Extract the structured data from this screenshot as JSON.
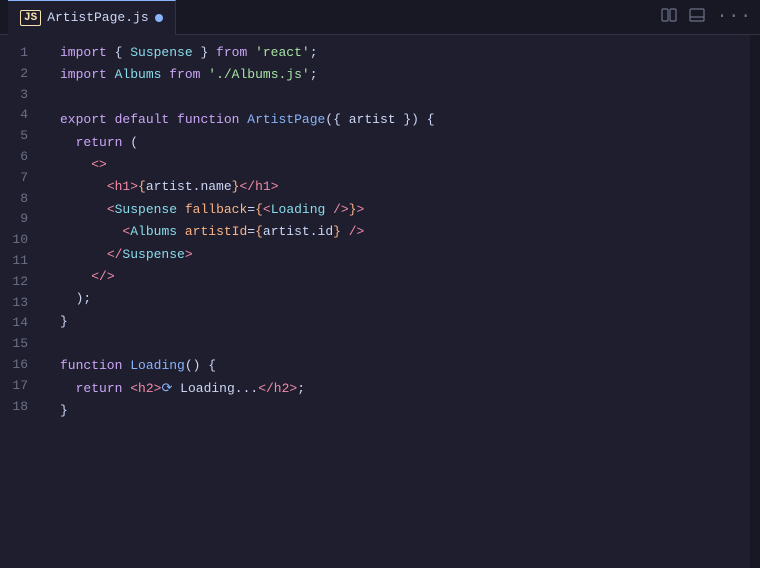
{
  "tab": {
    "icon_label": "JS",
    "filename": "ArtistPage.js",
    "modified": true
  },
  "toolbar": {
    "split_editor": "⊞",
    "toggle_panel": "□",
    "more": "···"
  },
  "lines": [
    {
      "number": "1",
      "content": "import { Suspense } from 'react';"
    },
    {
      "number": "2",
      "content": "import Albums from './Albums.js';"
    },
    {
      "number": "3",
      "content": ""
    },
    {
      "number": "4",
      "content": "export default function ArtistPage({ artist }) {"
    },
    {
      "number": "5",
      "content": "  return ("
    },
    {
      "number": "6",
      "content": "    <>"
    },
    {
      "number": "7",
      "content": "      <h1>{artist.name}</h1>"
    },
    {
      "number": "8",
      "content": "      <Suspense fallback={<Loading />}>"
    },
    {
      "number": "9",
      "content": "        <Albums artistId={artist.id} />"
    },
    {
      "number": "10",
      "content": "      </Suspense>"
    },
    {
      "number": "11",
      "content": "    </>"
    },
    {
      "number": "12",
      "content": "  );"
    },
    {
      "number": "13",
      "content": "}"
    },
    {
      "number": "14",
      "content": ""
    },
    {
      "number": "15",
      "content": "function Loading() {"
    },
    {
      "number": "16",
      "content": "  return <h2>⟳ Loading...</h2>;"
    },
    {
      "number": "17",
      "content": "}"
    },
    {
      "number": "18",
      "content": ""
    }
  ]
}
